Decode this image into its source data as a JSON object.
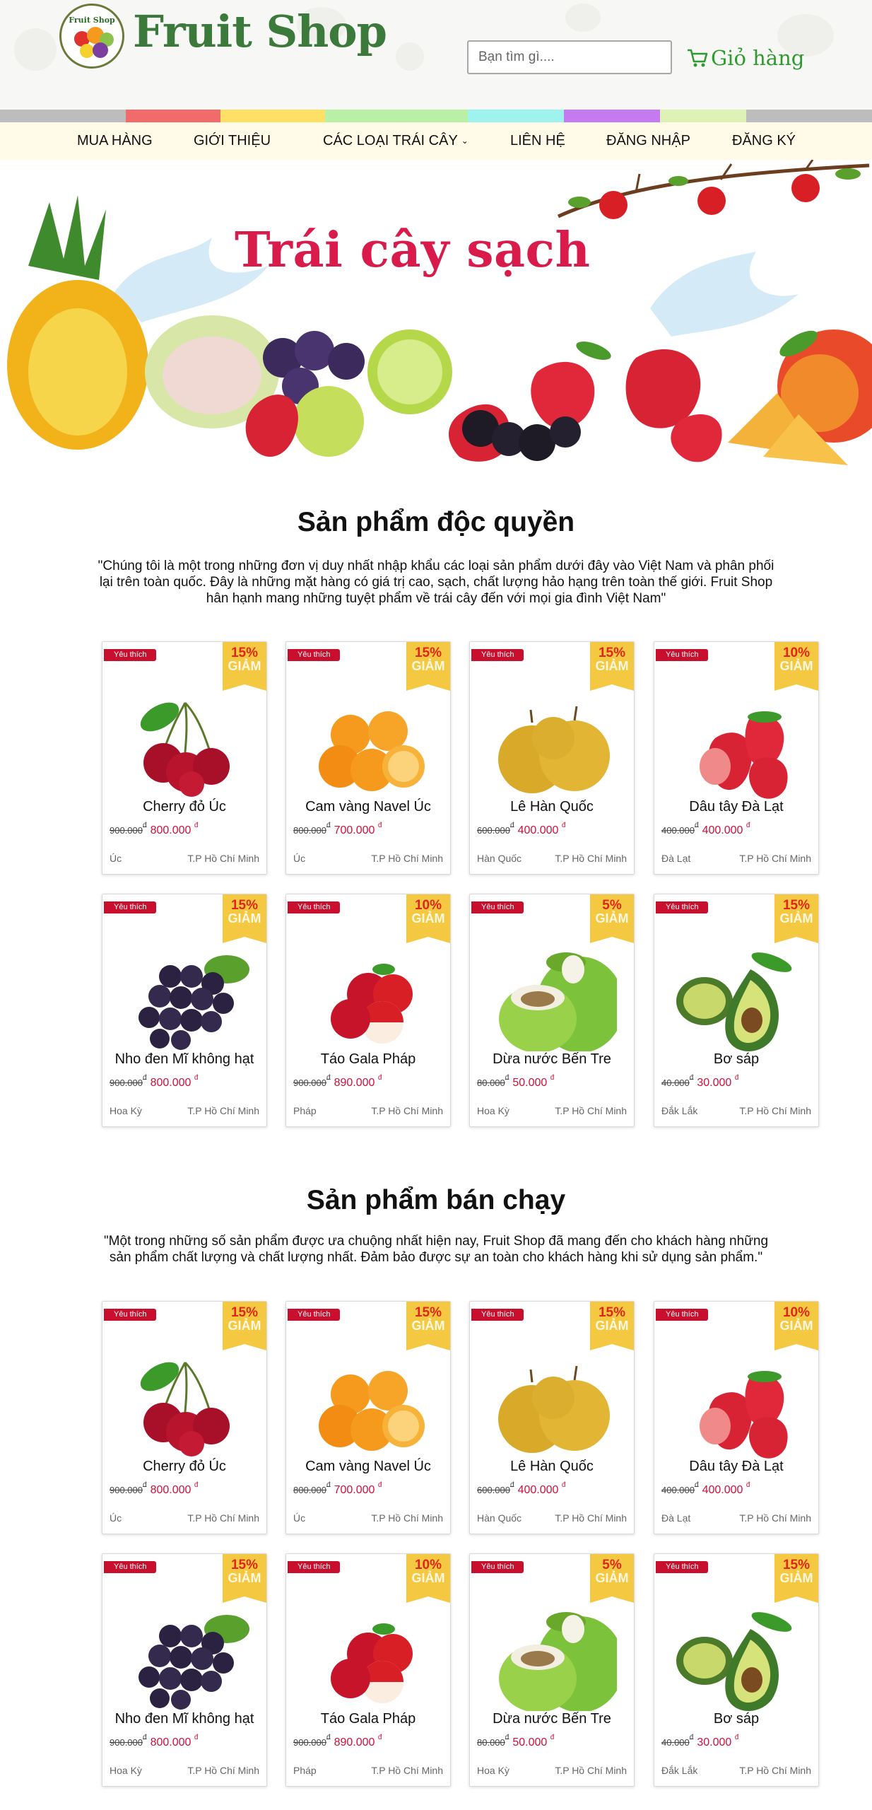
{
  "header": {
    "logo_mini": "Fruit Shop",
    "logo_text": "Fruit Shop",
    "search_placeholder": "Bạn tìm gì....",
    "cart_label": "Giỏ  hàng"
  },
  "colors": {
    "strip": [
      "#bdbdbd",
      "#f26b6b",
      "#ffe066",
      "#b9f0a6",
      "#9ff3ee",
      "#c57af0",
      "#dff2b6",
      "#bdbdbd"
    ],
    "nav_bg": "#fffbe8",
    "price": "#d10f3a",
    "badge": "#c8102e",
    "discount": "#f5c842"
  },
  "nav": {
    "items": [
      {
        "label": "MUA HÀNG"
      },
      {
        "label": "GIỚI THIỆU"
      },
      {
        "label": "CÁC LOẠI TRÁI CÂY",
        "dropdown": true
      },
      {
        "label": "LIÊN HỆ"
      },
      {
        "label": "ĐĂNG NHẬP"
      },
      {
        "label": "ĐĂNG KÝ"
      }
    ]
  },
  "banner": {
    "title": "Trái cây sạch"
  },
  "sections": [
    {
      "title": "Sản phẩm độc quyền",
      "description_lines": [
        "\"Chúng tôi là một trong những đơn vị duy nhất nhập khẩu các loại sản phẩm dưới đây vào Việt Nam và phân phối",
        "lại trên toàn quốc. Đây là những mặt hàng có giá trị cao, sạch, chất lượng hảo hạng trên toàn thế giới. Fruit Shop",
        "hân hạnh mang những tuyệt phẩm về trái cây đến với mọi gia đình Việt Nam\""
      ]
    },
    {
      "title": "Sản phẩm bán chạy",
      "description_lines": [
        "\"Một trong những số sản phẩm được ưa chuộng nhất hiện nay, Fruit Shop đã mang đến cho khách hàng những",
        "sản phẩm chất lượng và chất lượng nhất. Đảm bảo được sự an toàn cho khách hàng khi sử dụng sản phẩm.\""
      ]
    }
  ],
  "card_labels": {
    "favorite": "Yêu thích",
    "discount_word": "GIẢM",
    "currency": "đ"
  },
  "products": [
    {
      "name": "Cherry đỏ Úc",
      "discount": "15%",
      "old_price": "900.000",
      "new_price": "800.000",
      "origin": "Úc",
      "location": "T.P Hồ Chí Minh",
      "icon": "cherry-icon"
    },
    {
      "name": "Cam vàng Navel Úc",
      "discount": "15%",
      "old_price": "800.000",
      "new_price": "700.000",
      "origin": "Úc",
      "location": "T.P Hồ Chí Minh",
      "icon": "orange-icon"
    },
    {
      "name": "Lê Hàn Quốc",
      "discount": "15%",
      "old_price": "600.000",
      "new_price": "400.000",
      "origin": "Hàn Quốc",
      "location": "T.P Hồ Chí Minh",
      "icon": "pear-icon"
    },
    {
      "name": "Dâu tây Đà Lạt",
      "discount": "10%",
      "old_price": "400.000",
      "new_price": "400.000",
      "origin": "Đà Lạt",
      "location": "T.P Hồ Chí Minh",
      "icon": "strawberry-icon"
    },
    {
      "name": "Nho đen Mĩ không hạt",
      "discount": "15%",
      "old_price": "900.000",
      "new_price": "800.000",
      "origin": "Hoa Kỳ",
      "location": "T.P Hồ Chí Minh",
      "icon": "grape-icon"
    },
    {
      "name": "Táo Gala Pháp",
      "discount": "10%",
      "old_price": "900.000",
      "new_price": "890.000",
      "origin": "Pháp",
      "location": "T.P Hồ Chí Minh",
      "icon": "apple-icon"
    },
    {
      "name": "Dừa nước Bến Tre",
      "discount": "5%",
      "old_price": "80.000",
      "new_price": "50.000",
      "origin": "Hoa Kỳ",
      "location": "T.P Hồ Chí Minh",
      "icon": "coconut-icon"
    },
    {
      "name": "Bơ sáp",
      "discount": "15%",
      "old_price": "40.000",
      "new_price": "30.000",
      "origin": "Đắk Lắk",
      "location": "T.P Hồ Chí Minh",
      "icon": "avocado-icon"
    }
  ]
}
